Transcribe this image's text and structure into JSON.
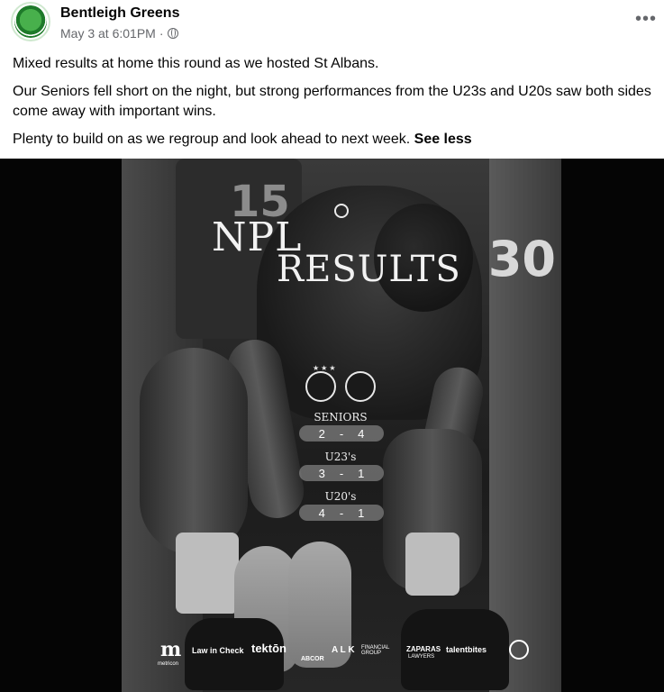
{
  "post": {
    "author": "Bentleigh Greens",
    "timestamp": "May 3 at 6:01PM",
    "separator": "·",
    "privacy_icon": "globe-icon",
    "more_label": "•••",
    "paragraphs": [
      "Mixed results at home this round as we hosted St Albans.",
      "Our Seniors fell short on the night, but strong performances from the U23s and U20s saw both sides come away with important wins.",
      "Plenty to build on as we regroup and look ahead to next week."
    ],
    "see_less_label": "See less"
  },
  "graphic": {
    "title_line1": "NPL",
    "title_line2": "RESULTS",
    "shirt_number_left": "15",
    "shirt_number_right": "30",
    "results": [
      {
        "label": "SENIORS",
        "home": "2",
        "dash": "-",
        "away": "4"
      },
      {
        "label": "U23's",
        "home": "3",
        "dash": "-",
        "away": "1"
      },
      {
        "label": "U20's",
        "home": "4",
        "dash": "-",
        "away": "1"
      }
    ],
    "sponsors": {
      "metricon_mark": "m",
      "metricon_name": "metricon",
      "lawincheck": "Law in Check",
      "tekton": "tektōn",
      "abcor": "ABCOR",
      "alk": "A L K",
      "alk_sub": "FINANCIAL GROUP",
      "zaparas": "ZAPARAS",
      "zaparas_sub": "LAWYERS",
      "talentbites": "talentbites"
    }
  }
}
